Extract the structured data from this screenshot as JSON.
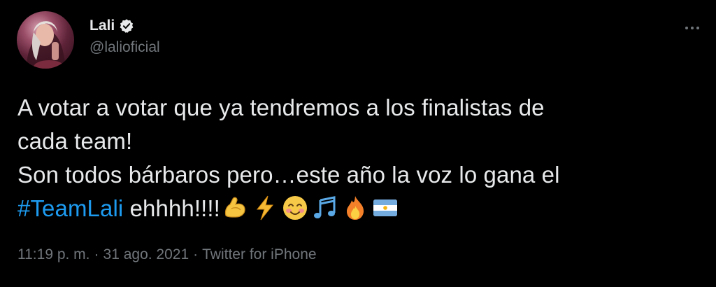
{
  "author": {
    "display_name": "Lali",
    "handle": "@lalioficial",
    "verified": true
  },
  "tweet": {
    "line1": "A votar a votar que ya tendremos a los finalistas de",
    "line2": "cada team!",
    "line3": "Son todos bárbaros pero…este año la voz lo gana el",
    "hashtag": "#TeamLali",
    "after_hashtag": " ehhhh!!!!",
    "emojis": [
      "flexed-biceps",
      "high-voltage",
      "smiling-face-blushing",
      "musical-notes",
      "fire",
      "flag-argentina"
    ]
  },
  "meta": {
    "time": "11:19 p. m.",
    "separator": "·",
    "date": "31 ago. 2021",
    "source": "Twitter for iPhone"
  },
  "colors": {
    "background": "#000000",
    "text": "#e7e9ea",
    "secondary": "#71767b",
    "link": "#1d9bf0"
  }
}
